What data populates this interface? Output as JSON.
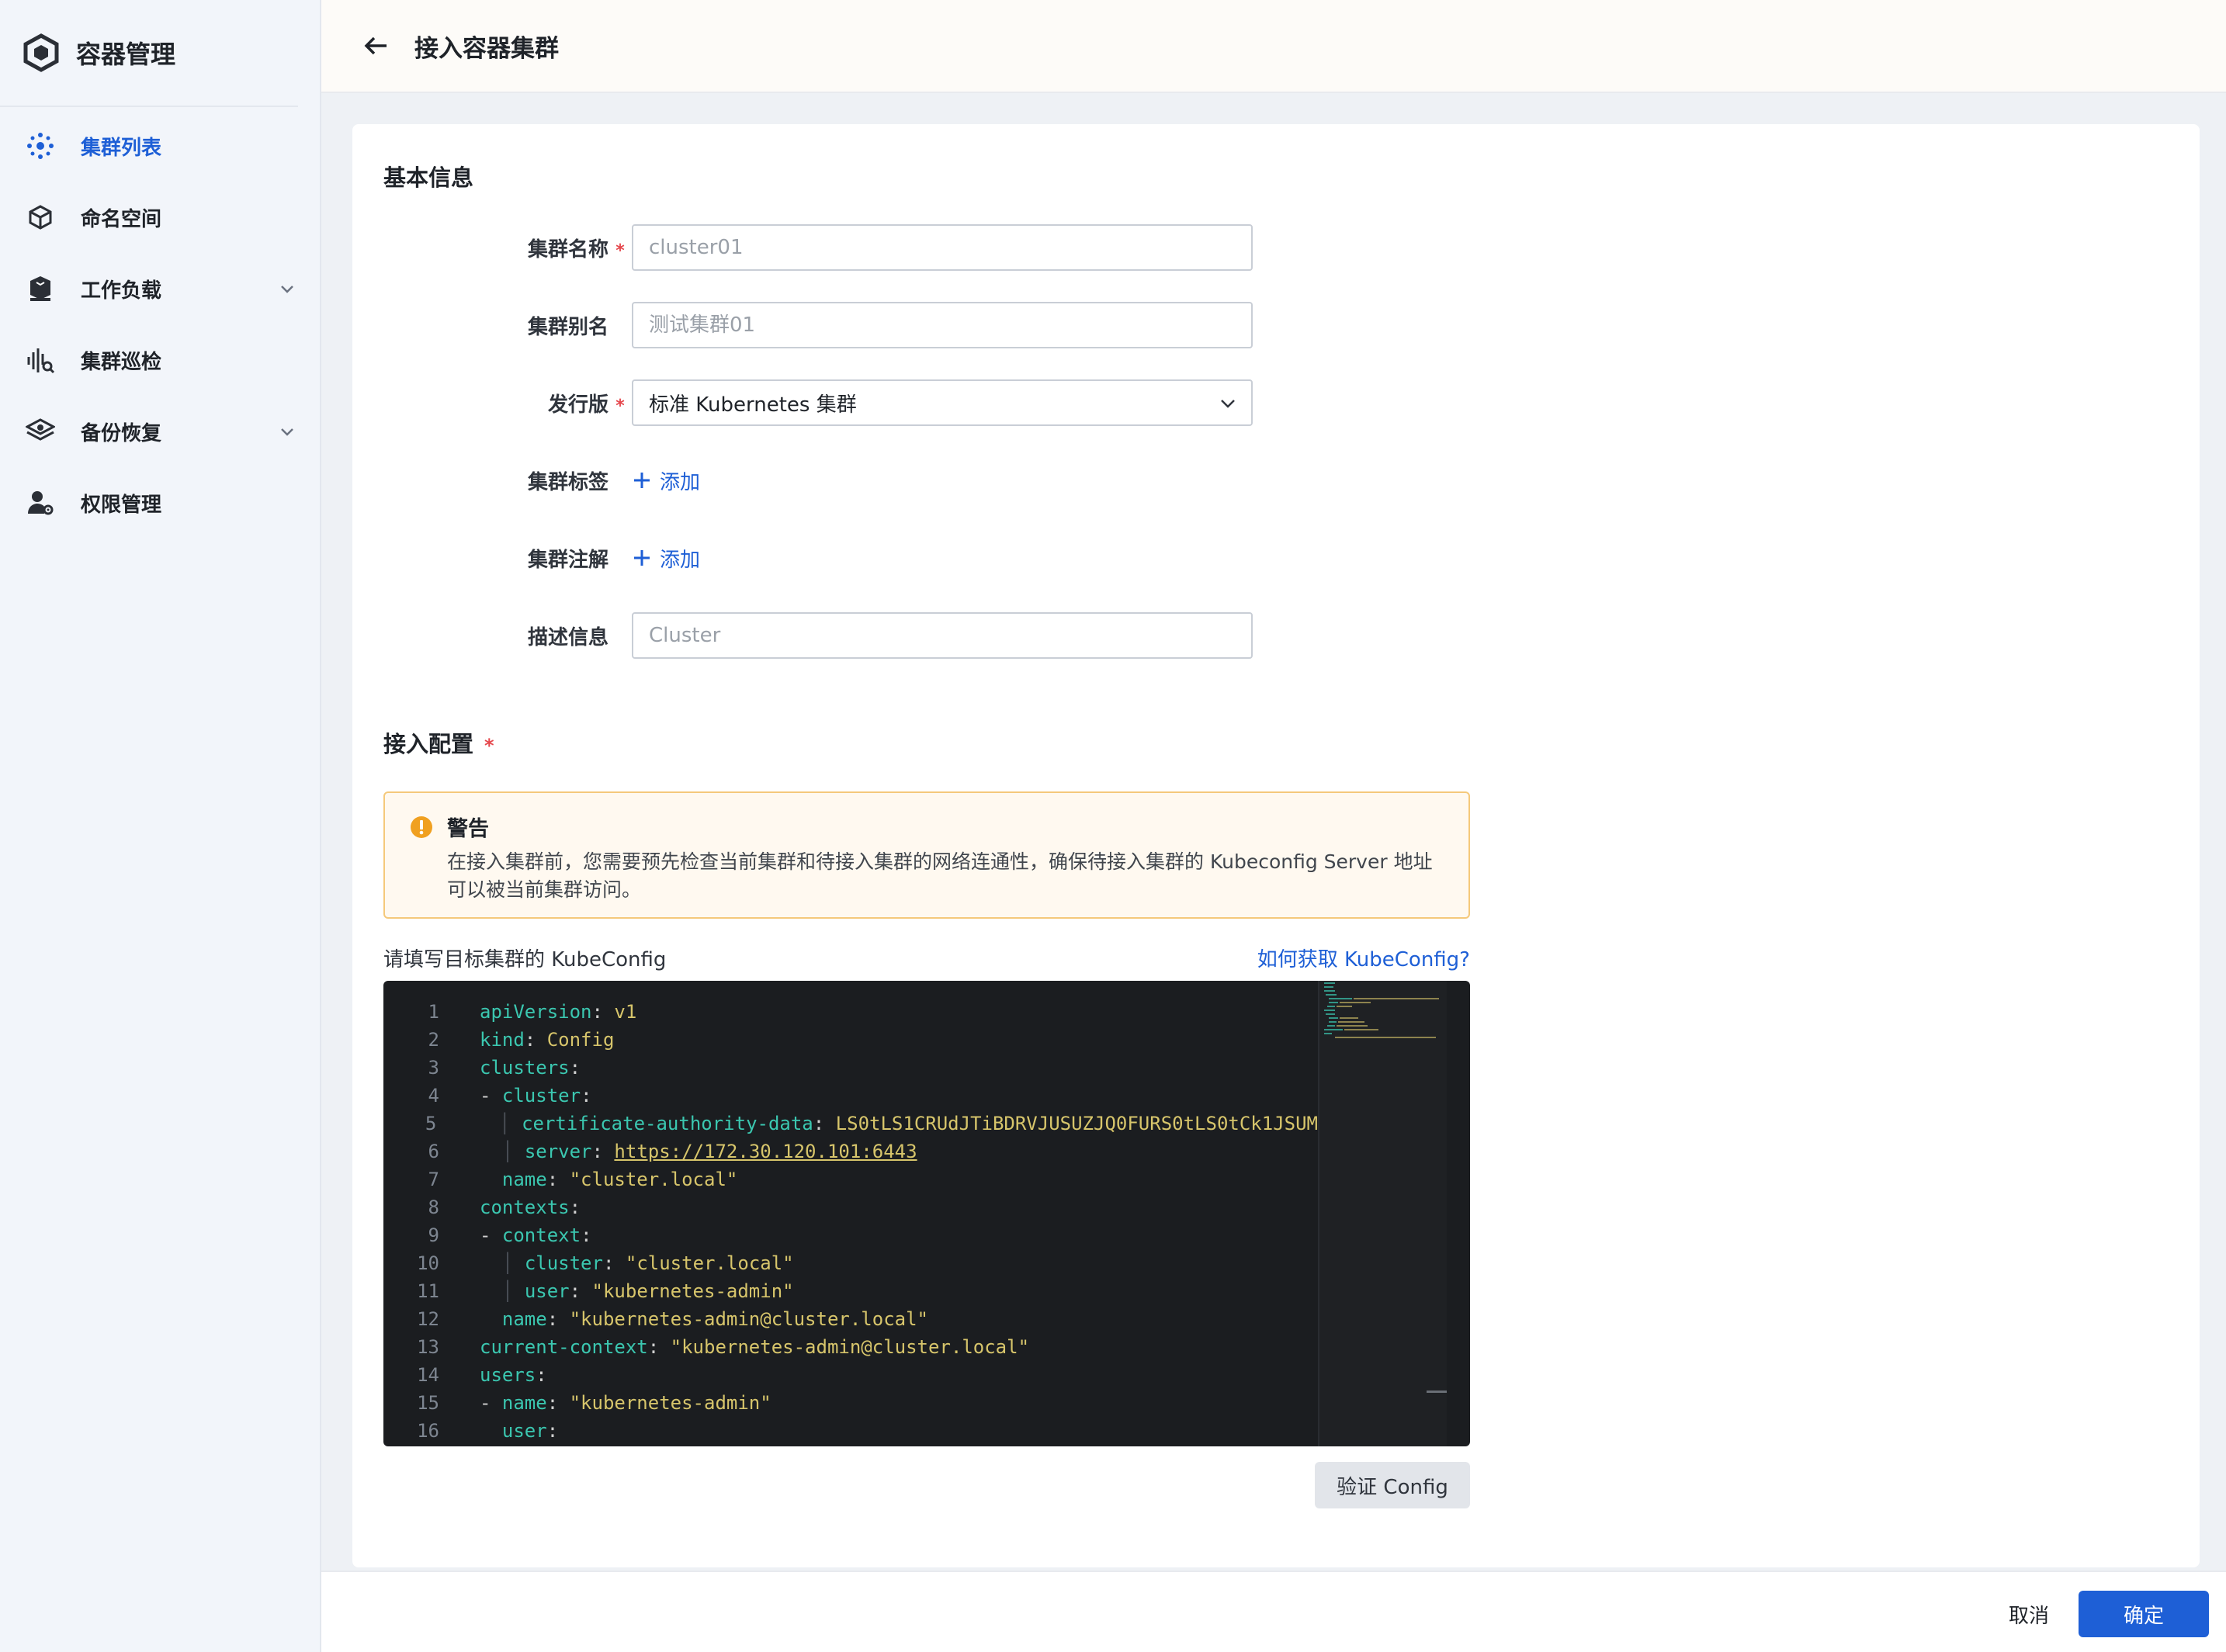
{
  "app": {
    "title": "容器管理",
    "logo_icon": "hexagon-logo-icon"
  },
  "sidebar": {
    "items": [
      {
        "label": "集群列表",
        "icon": "cluster-icon",
        "active": true
      },
      {
        "label": "命名空间",
        "icon": "cube-icon"
      },
      {
        "label": "工作负载",
        "icon": "workload-icon",
        "expandable": true
      },
      {
        "label": "集群巡检",
        "icon": "inspection-icon"
      },
      {
        "label": "备份恢复",
        "icon": "backup-icon",
        "expandable": true
      },
      {
        "label": "权限管理",
        "icon": "user-settings-icon"
      }
    ]
  },
  "header": {
    "title": "接入容器集群",
    "back_icon": "arrow-left-icon"
  },
  "basic": {
    "title": "基本信息",
    "cluster_name": {
      "label": "集群名称",
      "placeholder": "cluster01",
      "required": true
    },
    "cluster_alias": {
      "label": "集群别名",
      "placeholder": "测试集群01"
    },
    "distribution": {
      "label": "发行版",
      "value": "标准 Kubernetes 集群",
      "required": true
    },
    "labels": {
      "label": "集群标签",
      "add": "添加"
    },
    "annotations": {
      "label": "集群注解",
      "add": "添加"
    },
    "description": {
      "label": "描述信息",
      "placeholder": "Cluster"
    }
  },
  "access": {
    "title": "接入配置",
    "required_mark": "*",
    "warning": {
      "title": "警告",
      "body": "在接入集群前，您需要预先检查当前集群和待接入集群的网络连通性，确保待接入集群的 Kubeconfig Server 地址可以被当前集群访问。"
    },
    "kubeconfig_label": "请填写目标集群的 KubeConfig",
    "kubeconfig_help": "如何获取 KubeConfig?",
    "verify_button": "验证 Config",
    "editor_lines": [
      "apiVersion: v1",
      "kind: Config",
      "clusters:",
      "- cluster:",
      "    certificate-authority-data: LS0tLS1CRUdJTiBDRVJUSUZJQ0FURS0tLS0tCk1JSUM",
      "    server: https://172.30.120.101:6443",
      "  name: \"cluster.local\"",
      "contexts:",
      "- context:",
      "    cluster: \"cluster.local\"",
      "    user: \"kubernetes-admin\"",
      "  name: \"kubernetes-admin@cluster.local\"",
      "current-context: \"kubernetes-admin@cluster.local\"",
      "users:",
      "- name: \"kubernetes-admin\"",
      "  user:"
    ]
  },
  "footer": {
    "cancel": "取消",
    "confirm": "确定"
  },
  "colors": {
    "primary": "#1e5fd6",
    "required": "#e5484d",
    "warning_border": "#f5c97b",
    "editor_bg": "#1b1d20",
    "yaml_key": "#3bc7b0",
    "yaml_value": "#d7c56b"
  }
}
